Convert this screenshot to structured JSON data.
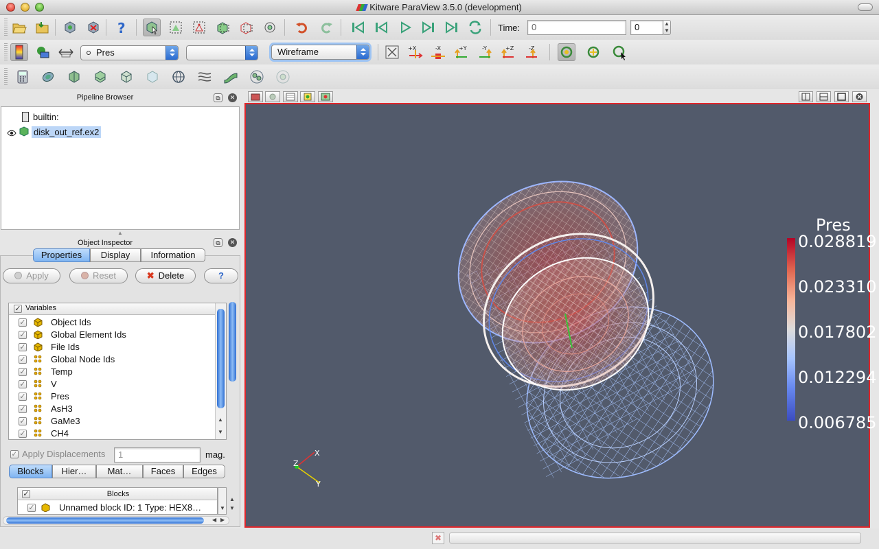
{
  "window": {
    "title": "Kitware ParaView 3.5.0 (development)"
  },
  "toolbar": {
    "time_label": "Time:",
    "time_value": "0",
    "time_step": "0",
    "color_by": "Pres",
    "component": "",
    "representation": "Wireframe"
  },
  "pipeline": {
    "title": "Pipeline Browser",
    "items": [
      {
        "label": "builtin:"
      },
      {
        "label": "disk_out_ref.ex2"
      }
    ]
  },
  "inspector": {
    "title": "Object Inspector",
    "tabs": [
      "Properties",
      "Display",
      "Information"
    ],
    "buttons": {
      "apply": "Apply",
      "reset": "Reset",
      "delete": "Delete",
      "help": "?"
    },
    "variables_header": "Variables",
    "variables": [
      {
        "label": "Object Ids",
        "icon": "cube-icon"
      },
      {
        "label": "Global Element Ids",
        "icon": "cube-icon"
      },
      {
        "label": "File Ids",
        "icon": "cube-icon"
      },
      {
        "label": "Global Node Ids",
        "icon": "points-icon"
      },
      {
        "label": "Temp",
        "icon": "points-icon"
      },
      {
        "label": "V",
        "icon": "points-icon"
      },
      {
        "label": "Pres",
        "icon": "points-icon"
      },
      {
        "label": "AsH3",
        "icon": "points-icon"
      },
      {
        "label": "GaMe3",
        "icon": "points-icon"
      },
      {
        "label": "CH4",
        "icon": "points-icon"
      }
    ],
    "apply_displacements": "Apply Displacements",
    "displacement_value": "1",
    "mag_label": "mag.",
    "subtabs": [
      "Blocks",
      "Hier…",
      "Mat…",
      "Faces",
      "Edges"
    ],
    "blocks_header": "Blocks",
    "block_row": "Unnamed block ID: 1 Type: HEX8…"
  },
  "view": {
    "legend": {
      "title": "Pres",
      "labels": [
        "0.028819",
        "0.023310",
        "0.017802",
        "0.012294",
        "0.006785"
      ]
    },
    "axes": {
      "x": "X",
      "y": "Y",
      "z": "Z"
    }
  },
  "colors": {
    "view_background": "#525a6b",
    "active_view_border": "#e0262b",
    "selection": "#bcd6f7"
  }
}
